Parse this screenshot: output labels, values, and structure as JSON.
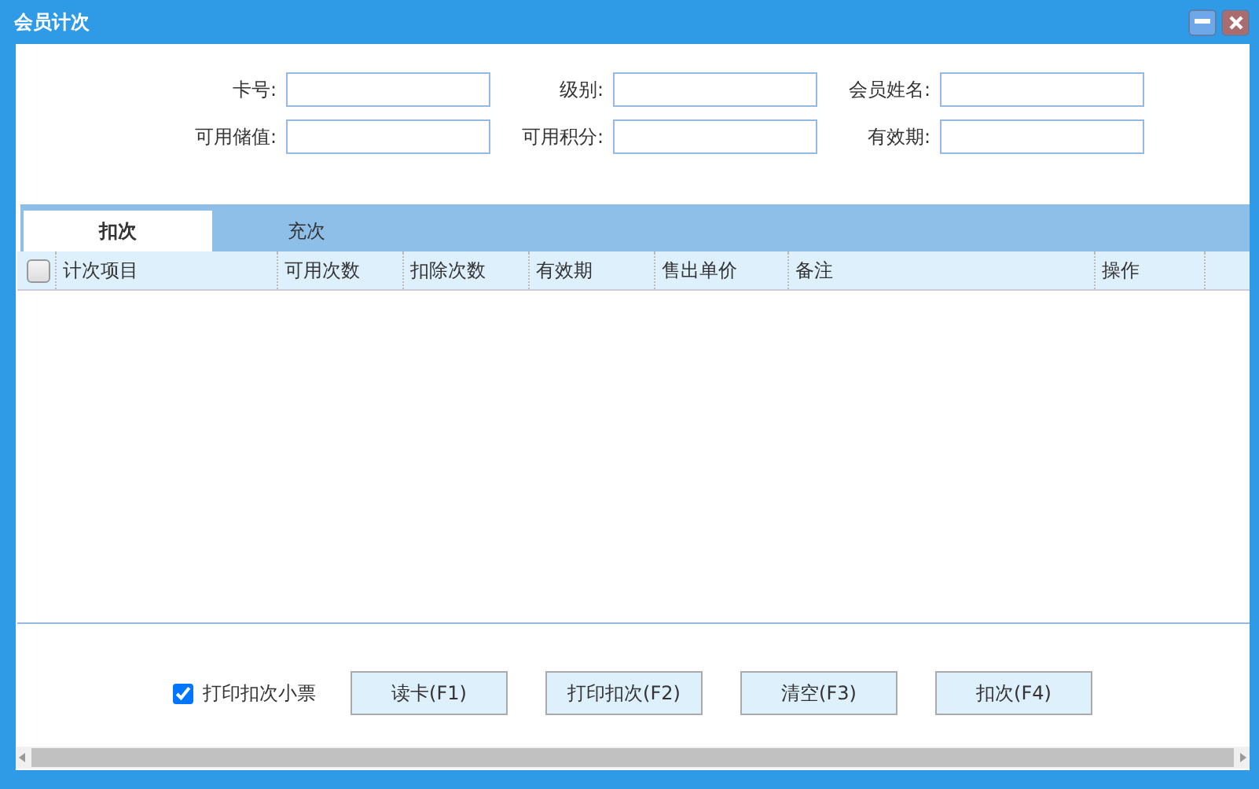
{
  "window": {
    "title": "会员计次"
  },
  "form": {
    "fields": [
      {
        "label": "卡号:"
      },
      {
        "label": "级别:"
      },
      {
        "label": "会员姓名:"
      },
      {
        "label": "可用储值:"
      },
      {
        "label": "可用积分:"
      },
      {
        "label": "有效期:"
      }
    ]
  },
  "tabs": [
    {
      "label": "扣次",
      "selected": true
    },
    {
      "label": "充次",
      "selected": false
    }
  ],
  "table": {
    "select_all_checked": false,
    "columns": [
      "计次项目",
      "可用次数",
      "扣除次数",
      "有效期",
      "售出单价",
      "备注",
      "操作"
    ]
  },
  "print_receipt": {
    "label": "打印扣次小票",
    "checked": true
  },
  "buttons": [
    "读卡(F1)",
    "打印扣次(F2)",
    "清空(F3)",
    "扣次(F4)"
  ]
}
